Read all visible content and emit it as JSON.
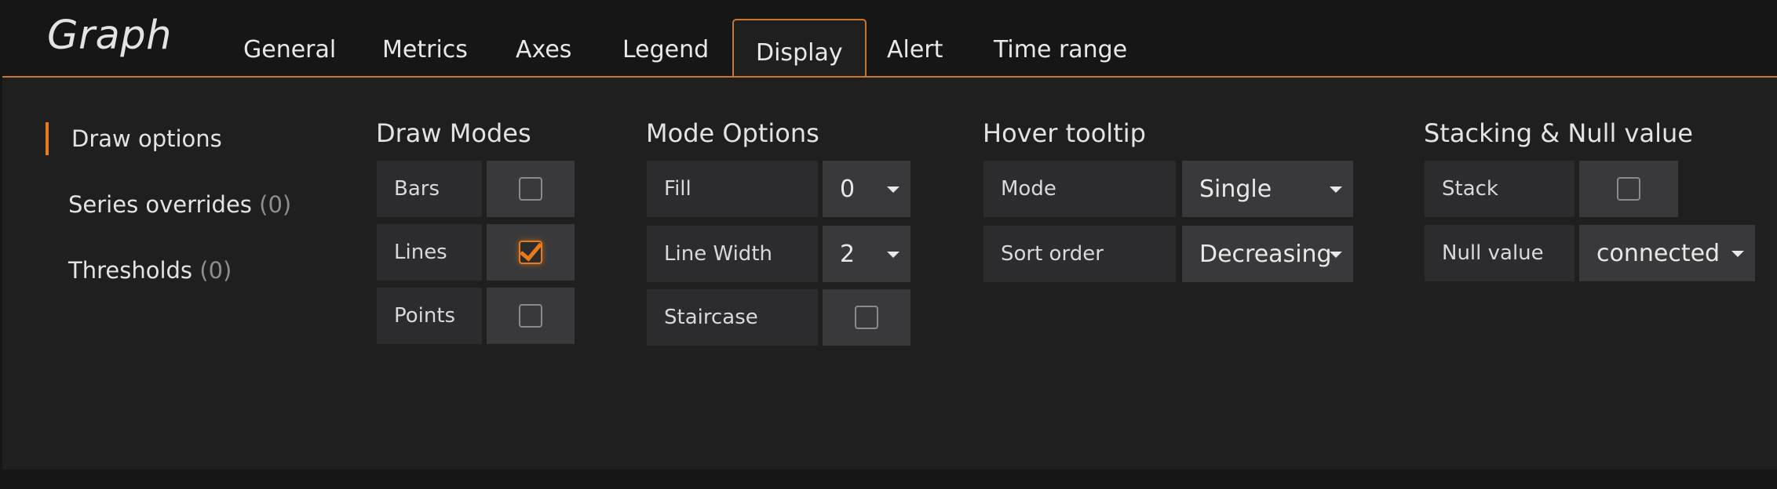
{
  "app": {
    "title": "Graph"
  },
  "tabs": [
    {
      "label": "General",
      "active": false
    },
    {
      "label": "Metrics",
      "active": false
    },
    {
      "label": "Axes",
      "active": false
    },
    {
      "label": "Legend",
      "active": false
    },
    {
      "label": "Display",
      "active": true
    },
    {
      "label": "Alert",
      "active": false
    },
    {
      "label": "Time range",
      "active": false
    }
  ],
  "sidebar": {
    "items": [
      {
        "label": "Draw options",
        "count": "",
        "active": true
      },
      {
        "label": "Series overrides",
        "count": "(0)",
        "active": false
      },
      {
        "label": "Thresholds",
        "count": "(0)",
        "active": false
      }
    ]
  },
  "draw_modes": {
    "title": "Draw Modes",
    "rows": [
      {
        "label": "Bars",
        "checked": false
      },
      {
        "label": "Lines",
        "checked": true
      },
      {
        "label": "Points",
        "checked": false
      }
    ]
  },
  "mode_options": {
    "title": "Mode Options",
    "fill": {
      "label": "Fill",
      "value": "0"
    },
    "line_width": {
      "label": "Line Width",
      "value": "2"
    },
    "staircase": {
      "label": "Staircase",
      "checked": false
    }
  },
  "hover_tooltip": {
    "title": "Hover tooltip",
    "mode": {
      "label": "Mode",
      "value": "Single"
    },
    "sort_order": {
      "label": "Sort order",
      "value": "Decreasing"
    }
  },
  "stacking": {
    "title": "Stacking & Null value",
    "stack": {
      "label": "Stack",
      "checked": false
    },
    "null_value": {
      "label": "Null value",
      "value": "connected"
    }
  },
  "colors": {
    "accent": "#eb7b18",
    "tab_border": "#c8772d",
    "background": "#1f1f20",
    "header": "#161616"
  }
}
